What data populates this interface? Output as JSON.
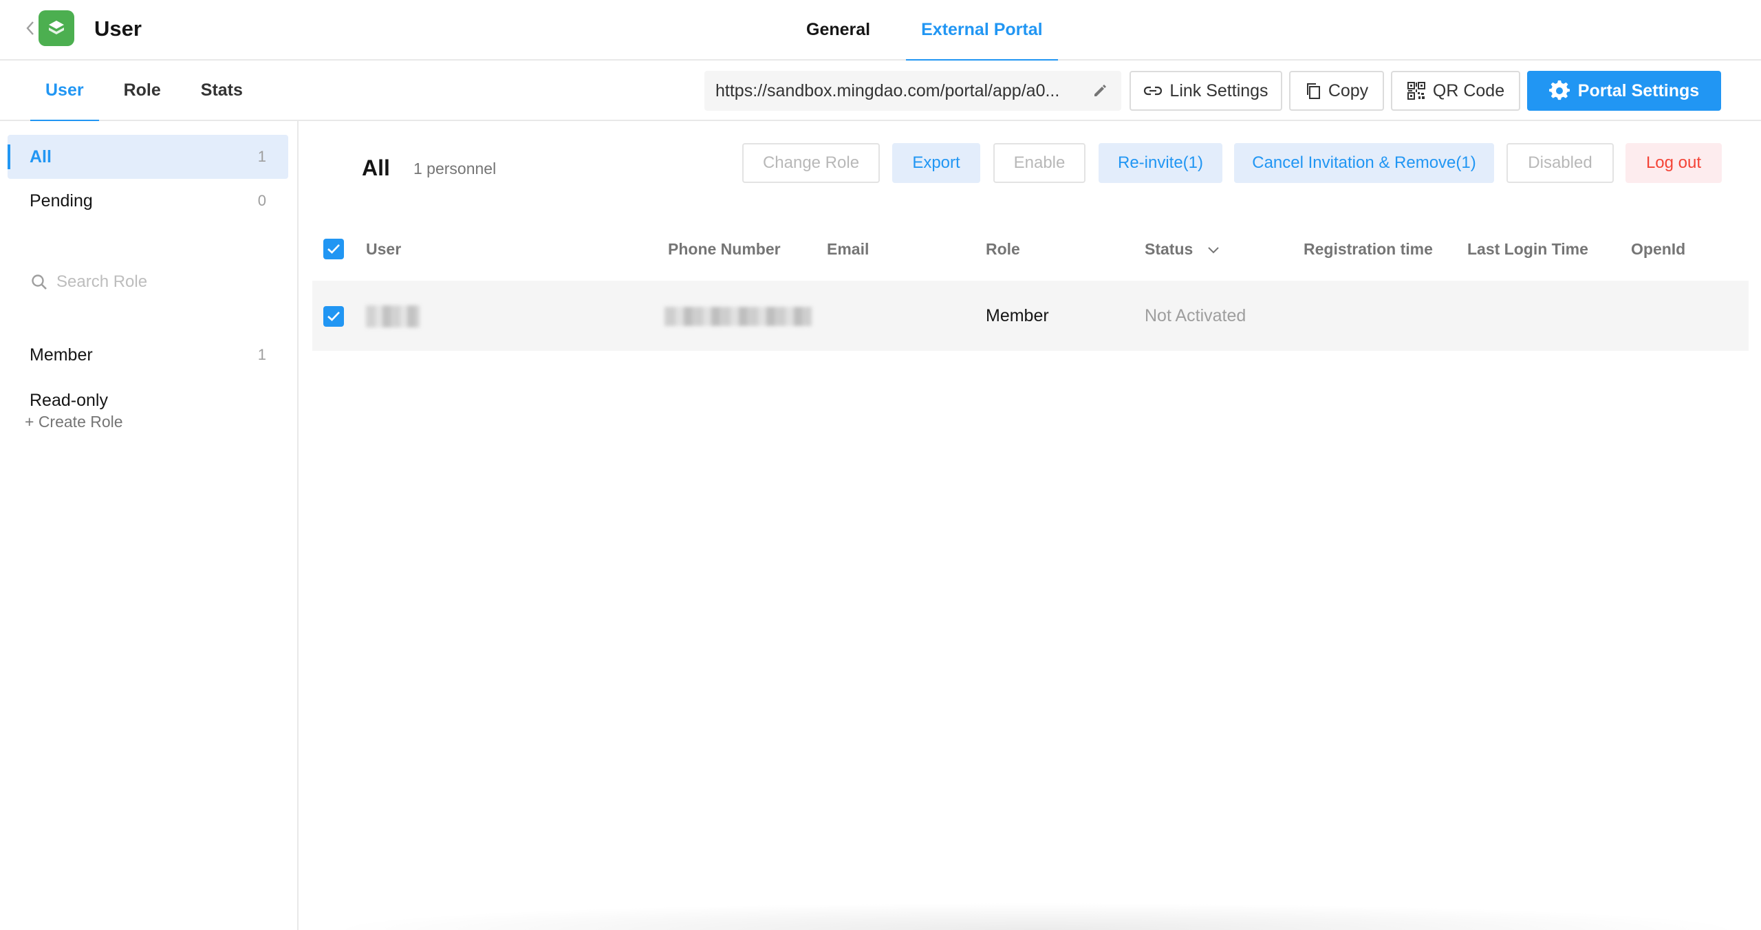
{
  "header": {
    "title": "User",
    "tabs": [
      {
        "label": "General",
        "active": false
      },
      {
        "label": "External Portal",
        "active": true
      }
    ]
  },
  "subnav": {
    "tabs": [
      {
        "label": "User",
        "active": true
      },
      {
        "label": "Role",
        "active": false
      },
      {
        "label": "Stats",
        "active": false
      }
    ],
    "portal_url": "https://sandbox.mingdao.com/portal/app/a0...",
    "buttons": {
      "link_settings": "Link Settings",
      "copy": "Copy",
      "qr_code": "QR Code",
      "portal_settings": "Portal Settings"
    }
  },
  "sidebar": {
    "filters": [
      {
        "label": "All",
        "count": "1",
        "active": true
      },
      {
        "label": "Pending",
        "count": "0",
        "active": false
      }
    ],
    "search_placeholder": "Search Role",
    "roles": [
      {
        "label": "Member",
        "count": "1"
      },
      {
        "label": "Read-only",
        "count": ""
      }
    ],
    "create_role": "+ Create Role"
  },
  "main": {
    "title": "All",
    "count_text": "1 personnel",
    "actions": {
      "change_role": "Change Role",
      "export": "Export",
      "enable": "Enable",
      "reinvite": "Re-invite(1)",
      "cancel_invite": "Cancel Invitation & Remove(1)",
      "disabled": "Disabled",
      "logout": "Log out"
    },
    "columns": {
      "user": "User",
      "phone": "Phone Number",
      "email": "Email",
      "role": "Role",
      "status": "Status",
      "registration": "Registration time",
      "last_login": "Last Login Time",
      "openid": "OpenId"
    },
    "rows": [
      {
        "user": "",
        "phone": "",
        "email": "",
        "role": "Member",
        "status": "Not Activated",
        "registration": "",
        "last_login": "",
        "openid": ""
      }
    ]
  },
  "colors": {
    "accent": "#2196f3",
    "logo": "#4caf50",
    "danger": "#f44336"
  }
}
